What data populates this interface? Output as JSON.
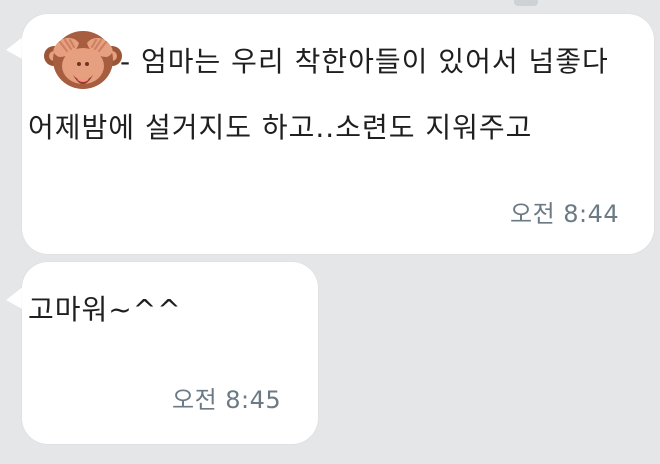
{
  "messages": [
    {
      "icon": "see-no-evil-monkey-icon",
      "lines": [
        "- 엄마는 우리 착한아들이 있어서 넘좋다",
        "어제밤에 설거지도 하고..소련도 지워주고"
      ],
      "time": "오전 8:44"
    },
    {
      "text": "고마워~^^",
      "time": "오전 8:45"
    }
  ],
  "colors": {
    "background": "#e5e6e8",
    "bubble": "#ffffff",
    "text": "#1f1f1f",
    "time": "#6b7a84",
    "monkey_face": "#a75d3f",
    "monkey_skin": "#e6a07f"
  }
}
